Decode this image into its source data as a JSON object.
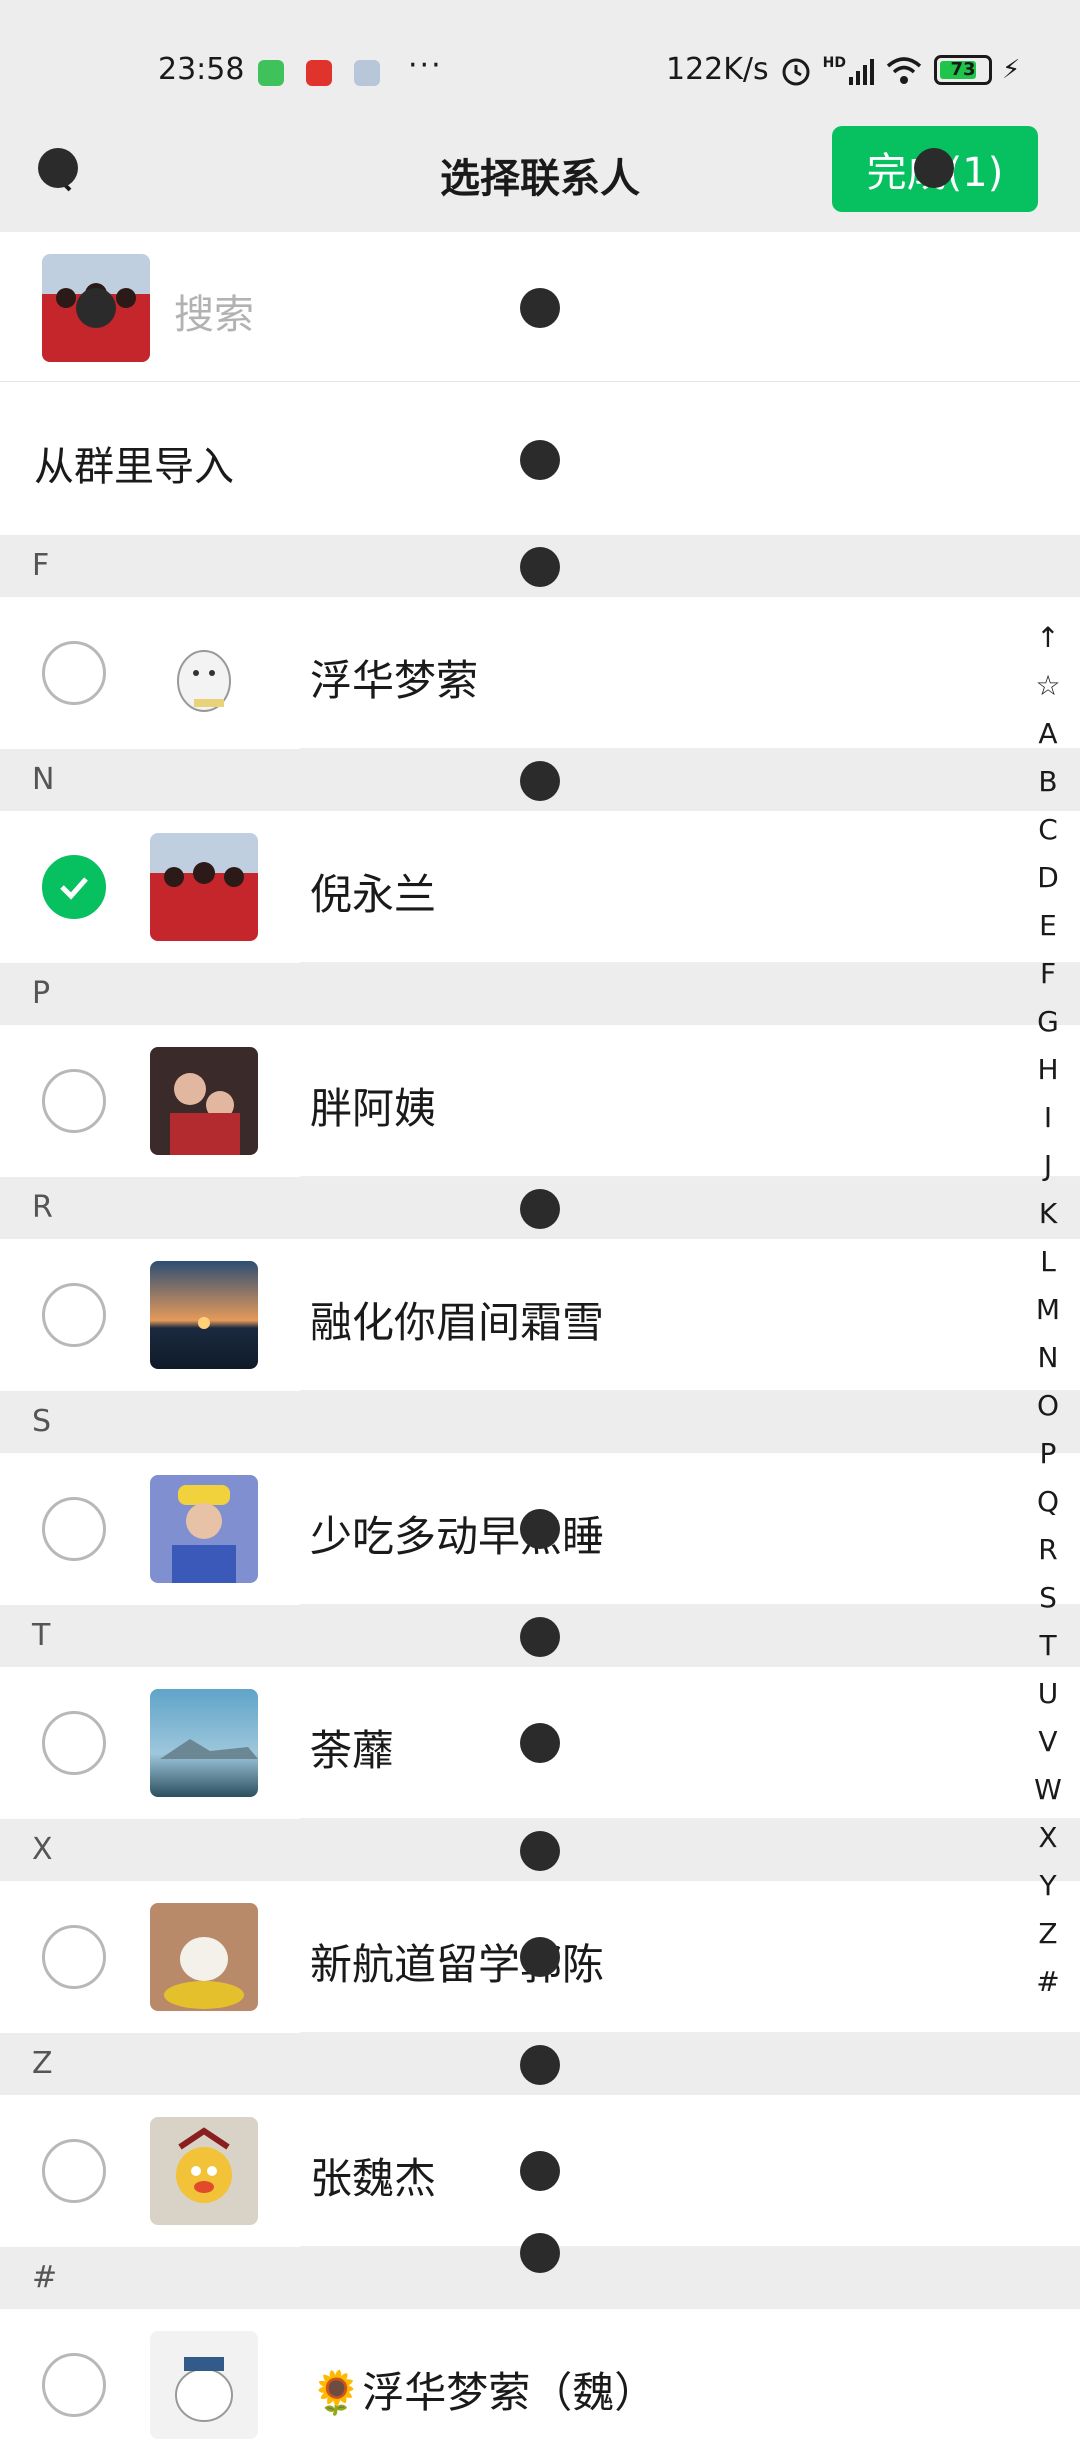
{
  "status_bar": {
    "time": "23:58",
    "more": "···",
    "network_speed": "122K/s",
    "signal_label": "HD",
    "battery_level": "73"
  },
  "nav": {
    "title": "选择联系人",
    "done_label": "完成(1)"
  },
  "search": {
    "placeholder": "搜索"
  },
  "import_from_group": "从群里导入",
  "sections": [
    {
      "letter": "F",
      "contacts": [
        {
          "name": "浮华梦萦",
          "checked": false,
          "avatar": "avatar-cartoon-ghost"
        }
      ]
    },
    {
      "letter": "N",
      "contacts": [
        {
          "name": "倪永兰",
          "checked": true,
          "avatar": "avatar-group-red"
        }
      ]
    },
    {
      "letter": "P",
      "contacts": [
        {
          "name": "胖阿姨",
          "checked": false,
          "avatar": "avatar-family"
        }
      ]
    },
    {
      "letter": "R",
      "contacts": [
        {
          "name": "融化你眉间霜雪",
          "checked": false,
          "avatar": "avatar-sunset"
        }
      ]
    },
    {
      "letter": "S",
      "contacts": [
        {
          "name": "少吃多动早点睡",
          "checked": false,
          "avatar": "avatar-singer"
        }
      ]
    },
    {
      "letter": "T",
      "contacts": [
        {
          "name": "荼蘼",
          "checked": false,
          "avatar": "avatar-mountain"
        }
      ]
    },
    {
      "letter": "X",
      "contacts": [
        {
          "name": "新航道留学郭陈",
          "checked": false,
          "avatar": "avatar-cat"
        }
      ]
    },
    {
      "letter": "Z",
      "contacts": [
        {
          "name": "张魏杰",
          "checked": false,
          "avatar": "avatar-cartoon-warrior"
        }
      ]
    },
    {
      "letter": "#",
      "contacts": [
        {
          "name": "🌻浮华梦萦（魏）",
          "checked": false,
          "avatar": "avatar-cartoon-white"
        }
      ]
    }
  ],
  "alpha_index": [
    "↑",
    "☆",
    "A",
    "B",
    "C",
    "D",
    "E",
    "F",
    "G",
    "H",
    "I",
    "J",
    "K",
    "L",
    "M",
    "N",
    "O",
    "P",
    "Q",
    "R",
    "S",
    "T",
    "U",
    "V",
    "W",
    "X",
    "Y",
    "Z",
    "#"
  ],
  "colors": {
    "accent_green": "#07c160",
    "header_gray": "#ededed"
  }
}
